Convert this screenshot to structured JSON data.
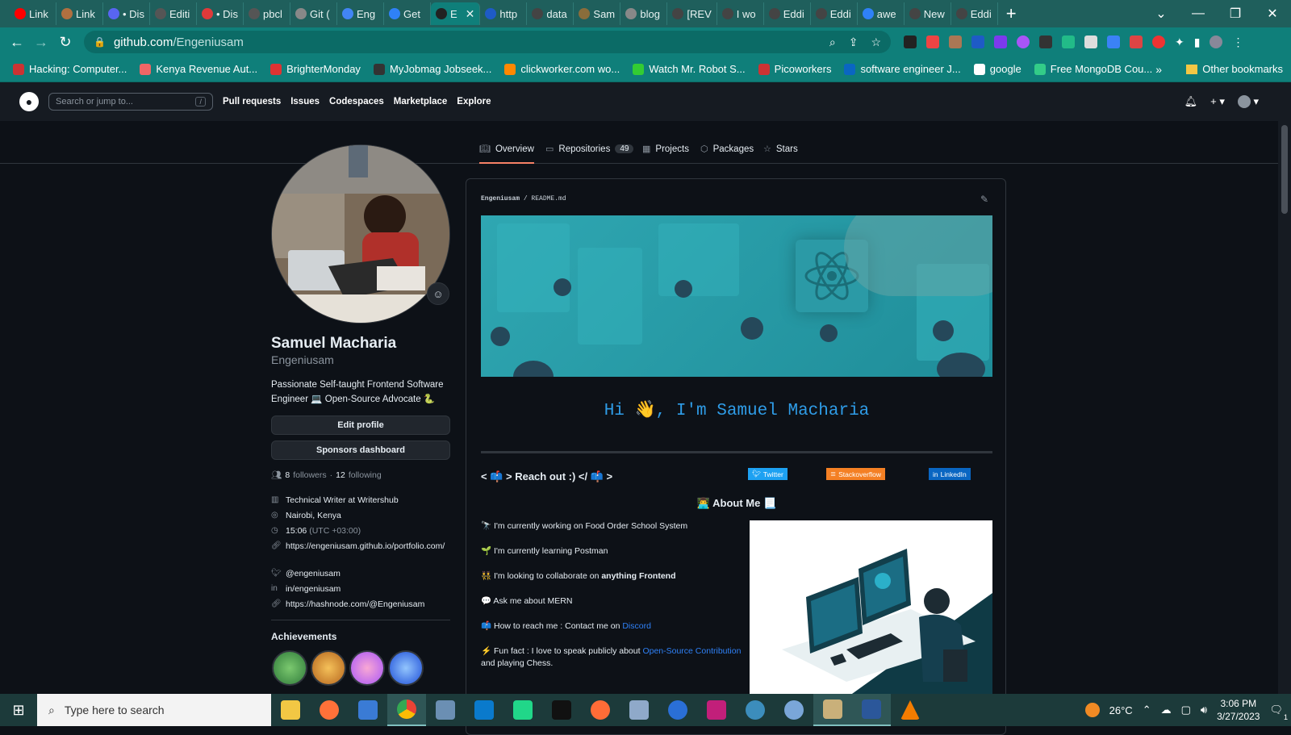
{
  "browser": {
    "tabs": [
      {
        "title": "Link",
        "color": "#ff0000"
      },
      {
        "title": "Link",
        "color": "#b07040"
      },
      {
        "title": "• Dis",
        "color": "#5865f2"
      },
      {
        "title": "Editi",
        "color": "#555555"
      },
      {
        "title": "• Dis",
        "color": "#e03a3a"
      },
      {
        "title": "pbcl",
        "color": "#555555"
      },
      {
        "title": "Git (",
        "color": "#888888"
      },
      {
        "title": "Eng",
        "color": "#4285f4"
      },
      {
        "title": "Get",
        "color": "#2f81f7"
      },
      {
        "title": "E",
        "color": "#222222",
        "active": true
      },
      {
        "title": "http",
        "color": "#1e5bc6"
      },
      {
        "title": "data",
        "color": "#444444"
      },
      {
        "title": "Sam",
        "color": "#8a6d3b"
      },
      {
        "title": "blog",
        "color": "#888888"
      },
      {
        "title": "[REV",
        "color": "#444444"
      },
      {
        "title": "I wo",
        "color": "#444444"
      },
      {
        "title": "Eddi",
        "color": "#444444"
      },
      {
        "title": "Eddi",
        "color": "#444444"
      },
      {
        "title": "awe",
        "color": "#2f81f7"
      },
      {
        "title": "New",
        "color": "#444444"
      },
      {
        "title": "Eddi",
        "color": "#444444"
      }
    ],
    "url_host": "github.com",
    "url_path": "/Engeniusam",
    "bookmarks": [
      {
        "label": "Hacking: Computer...",
        "color": "#c33"
      },
      {
        "label": "Kenya Revenue Aut...",
        "color": "#e66"
      },
      {
        "label": "BrighterMonday",
        "color": "#d33"
      },
      {
        "label": "MyJobmag Jobseek...",
        "color": "#333"
      },
      {
        "label": "clickworker.com wo...",
        "color": "#f80"
      },
      {
        "label": "Watch Mr. Robot S...",
        "color": "#3c3"
      },
      {
        "label": "Picoworkers",
        "color": "#c33"
      },
      {
        "label": "software engineer J...",
        "color": "#0a66c2"
      },
      {
        "label": "google",
        "color": "#fff"
      },
      {
        "label": "Free MongoDB Cou...",
        "color": "#3c8"
      }
    ],
    "other_bookmarks": "Other bookmarks"
  },
  "github": {
    "search_placeholder": "Search or jump to...",
    "search_key": "/",
    "nav": [
      "Pull requests",
      "Issues",
      "Codespaces",
      "Marketplace",
      "Explore"
    ],
    "tabs": {
      "overview": "Overview",
      "repositories": "Repositories",
      "repo_count": "49",
      "projects": "Projects",
      "packages": "Packages",
      "stars": "Stars"
    }
  },
  "profile": {
    "full_name": "Samuel Macharia",
    "username": "Engeniusam",
    "bio": "Passionate Self-taught Frontend Software Engineer 💻 Open-Source Advocate 🐍",
    "edit_profile": "Edit profile",
    "sponsors_dashboard": "Sponsors dashboard",
    "followers_count": "8",
    "followers_label": "followers",
    "following_count": "12",
    "following_label": "following",
    "company": "Technical Writer at Writershub",
    "location": "Nairobi, Kenya",
    "local_time": "15:06",
    "timezone": "(UTC +03:00)",
    "website": "https://engeniusam.github.io/portfolio.com/",
    "twitter": "@engeniusam",
    "linkedin": "in/engeniusam",
    "hashnode": "https://hashnode.com/@Engeniusam",
    "achievements_title": "Achievements"
  },
  "readme": {
    "path_user": "Engeniusam",
    "path_file": "README.md",
    "greeting": "Hi 👋, I'm Samuel Macharia",
    "reach_out": "< 📫 > Reach out :) </ 📫 >",
    "badges": [
      {
        "label": "Twitter",
        "color": "#1da1f2"
      },
      {
        "label": "Stackoverflow",
        "color": "#f48024"
      },
      {
        "label": "LinkedIn",
        "color": "#0a66c2"
      }
    ],
    "about_title": "👨‍💻 About Me 📃",
    "items": [
      {
        "icon": "🔭",
        "text": "I'm currently working on Food Order School System"
      },
      {
        "icon": "🌱",
        "text": "I'm currently learning Postman"
      },
      {
        "icon": "👯",
        "text": "I'm looking to collaborate on ",
        "bold": "anything Frontend"
      },
      {
        "icon": "💬",
        "text": "Ask me about MERN"
      },
      {
        "icon": "📫",
        "text": "How to reach me : Contact me on ",
        "link": "Discord"
      },
      {
        "icon": "⚡",
        "text": "Fun fact : I love to speak publicly about ",
        "link": "Open-Source Contribution",
        "tail": "and playing Chess."
      }
    ]
  },
  "taskbar": {
    "search_placeholder": "Type here to search",
    "temperature": "26°C",
    "time": "3:06 PM",
    "date": "3/27/2023",
    "notification_count": "1"
  }
}
